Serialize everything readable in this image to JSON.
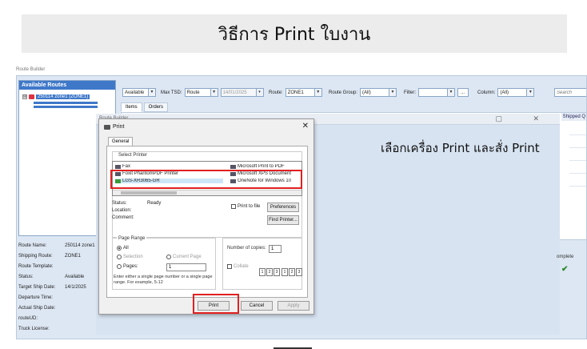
{
  "banner": {
    "title": "วิธีการ Print ใบงาน"
  },
  "app": {
    "window_label": "Route Builder",
    "routes_panel": {
      "header": "Available Routes",
      "route_item": "250114 zone1 (ZONE1)",
      "expander": "⊞"
    },
    "toolbar": {
      "status_value": "Available",
      "max_tsd_label": "Max TSD:",
      "max_tsd_type": "Route",
      "date_value": "14/01/2025",
      "route_label": "Route:",
      "route_value": "ZONE1",
      "route_group_label": "Route Group:",
      "route_group_value": "(All)",
      "filter_label": "Filter:",
      "filter_value": "",
      "ellipsis": "...",
      "column_label": "Column:",
      "column_value": "(All)",
      "search_placeholder": "Search"
    },
    "tabs": [
      "Items",
      "Orders"
    ],
    "grid": {
      "shipped_header": "Shipped Q"
    },
    "details": [
      {
        "label": "Route Name:",
        "value": "250114 zone1"
      },
      {
        "label": "Shipping Route:",
        "value": "ZONE1"
      },
      {
        "label": "Route Template:",
        "value": ""
      },
      {
        "label": "Status:",
        "value": "Available"
      },
      {
        "label": "Target Ship Date:",
        "value": "14/1/2025"
      },
      {
        "label": "Departure Time:",
        "value": ""
      },
      {
        "label": "Actual Ship Date:",
        "value": ""
      },
      {
        "label": "routeUD:",
        "value": ""
      },
      {
        "label": "Truck License:",
        "value": ""
      }
    ],
    "builder_window": {
      "title": "Route Builder",
      "controls": "▢ ✕"
    },
    "side_column": {
      "header": "omplete",
      "check": "✔"
    }
  },
  "print_dialog": {
    "title": "Print",
    "close": "✕",
    "tab": "General",
    "select_printer_label": "Select Printer",
    "printers": [
      {
        "name": "Fax",
        "icon": "printer-icon",
        "selected": false
      },
      {
        "name": "Foxit PhantomPDF Printer",
        "icon": "printer-icon",
        "selected": false
      },
      {
        "name": "LGS-XR3065-GR",
        "icon": "printer-default-icon",
        "selected": true
      },
      {
        "name": "Microsoft Print to PDF",
        "icon": "printer-icon",
        "selected": false
      },
      {
        "name": "Microsoft XPS Document",
        "icon": "printer-icon",
        "selected": false
      },
      {
        "name": "OneNote for Windows 10",
        "icon": "printer-icon",
        "selected": false
      }
    ],
    "status_label": "Status:",
    "status_value": "Ready",
    "location_label": "Location:",
    "comment_label": "Comment:",
    "print_to_file": "Print to file",
    "preferences": "Preferences",
    "find_printer": "Find Printer...",
    "page_range": {
      "label": "Page Range",
      "all": "All",
      "selection": "Selection",
      "current_page": "Current Page",
      "pages": "Pages:",
      "pages_value": "1",
      "hint": "Enter either a single page number or a single page range.  For example, 5-12"
    },
    "copies_label": "Number of copies:",
    "copies_value": "1",
    "collate": "Collate",
    "buttons": {
      "print": "Print",
      "cancel": "Cancel",
      "apply": "Apply"
    }
  },
  "annotation": {
    "text": "เลือกเครื่อง Print และสั่ง Print"
  },
  "colors": {
    "highlight": "#e02020",
    "accent": "#3f78c9"
  }
}
